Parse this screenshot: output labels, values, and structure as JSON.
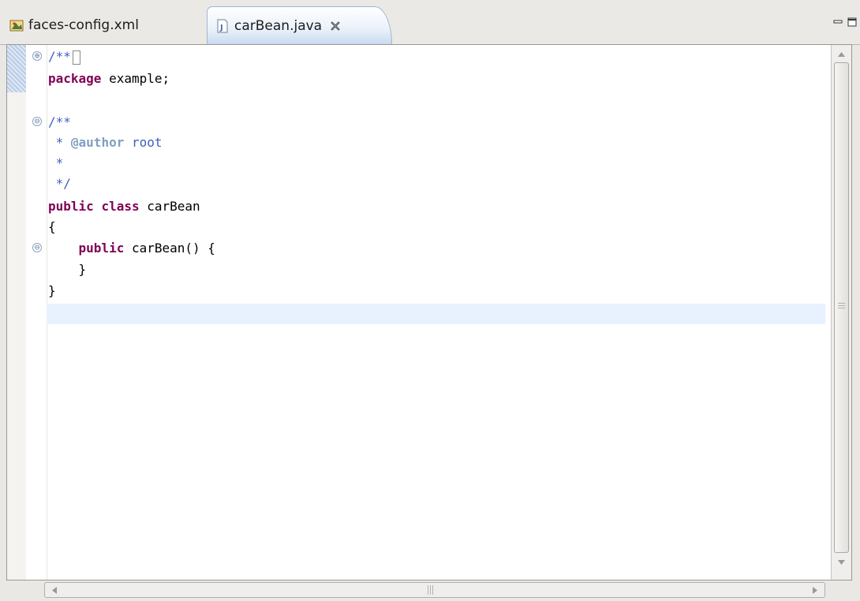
{
  "tabs": [
    {
      "label": "faces-config.xml",
      "icon": "faces-config-icon",
      "active": false
    },
    {
      "label": "carBean.java",
      "icon": "java-file-icon",
      "active": true,
      "close_icon": "close-tab-icon"
    }
  ],
  "window_controls": {
    "minimize_icon": "minimize-icon",
    "maximize_icon": "maximize-icon"
  },
  "editor": {
    "code": {
      "l1": "/**",
      "l2_kw": "package",
      "l2_rest": " example;",
      "l4": "/**",
      "l5_star": " * ",
      "l5_tag": "@author",
      "l5_rest": " root",
      "l6": " *",
      "l7": " */",
      "l8_kw1": "public",
      "l8_kw2": "class",
      "l8_rest": " carBean",
      "l9": "{",
      "l10_kw": "public",
      "l10_rest": " carBean() {",
      "l11": "    }",
      "l12": "}"
    },
    "fold_icons": {
      "expand": "⊕",
      "collapse": "⊖"
    }
  },
  "colors": {
    "keyword": "#7f0055",
    "javadoc": "#3f5fbf",
    "javadoc_tag": "#7f9fbf",
    "current_line": "#e8f2fe",
    "active_tab": "#c9daf0"
  }
}
